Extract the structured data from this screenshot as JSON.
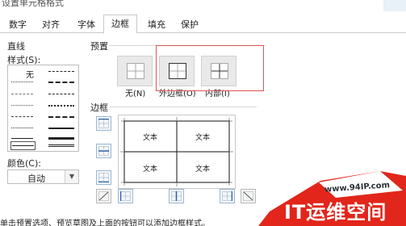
{
  "dialog": {
    "title": "设置单元格格式",
    "tabs": [
      {
        "label": "数字",
        "active": false
      },
      {
        "label": "对齐",
        "active": false
      },
      {
        "label": "字体",
        "active": false
      },
      {
        "label": "边框",
        "active": true
      },
      {
        "label": "填充",
        "active": false
      },
      {
        "label": "保护",
        "active": false
      }
    ]
  },
  "line": {
    "group_label": "直线",
    "style_label": "样式(S):",
    "none_label": "无",
    "color_label": "颜色(C):",
    "color_value": "自动"
  },
  "presets": {
    "group_label": "预置",
    "items": [
      {
        "label": "无(N)",
        "icon": "preset-none-icon"
      },
      {
        "label": "外边框(O)",
        "icon": "preset-outline-icon"
      },
      {
        "label": "内部(I)",
        "icon": "preset-inside-icon"
      }
    ]
  },
  "border": {
    "group_label": "边框",
    "cells": [
      "文本",
      "文本",
      "文本",
      "文本"
    ]
  },
  "hint": "单击预置选项、预览草图及上面的按钮可以添加边框样式。",
  "watermark": {
    "url": "www.94IP.com",
    "title": "IT运维空间"
  },
  "colors": {
    "highlight": "#e05555",
    "watermark": "#e2261b"
  }
}
